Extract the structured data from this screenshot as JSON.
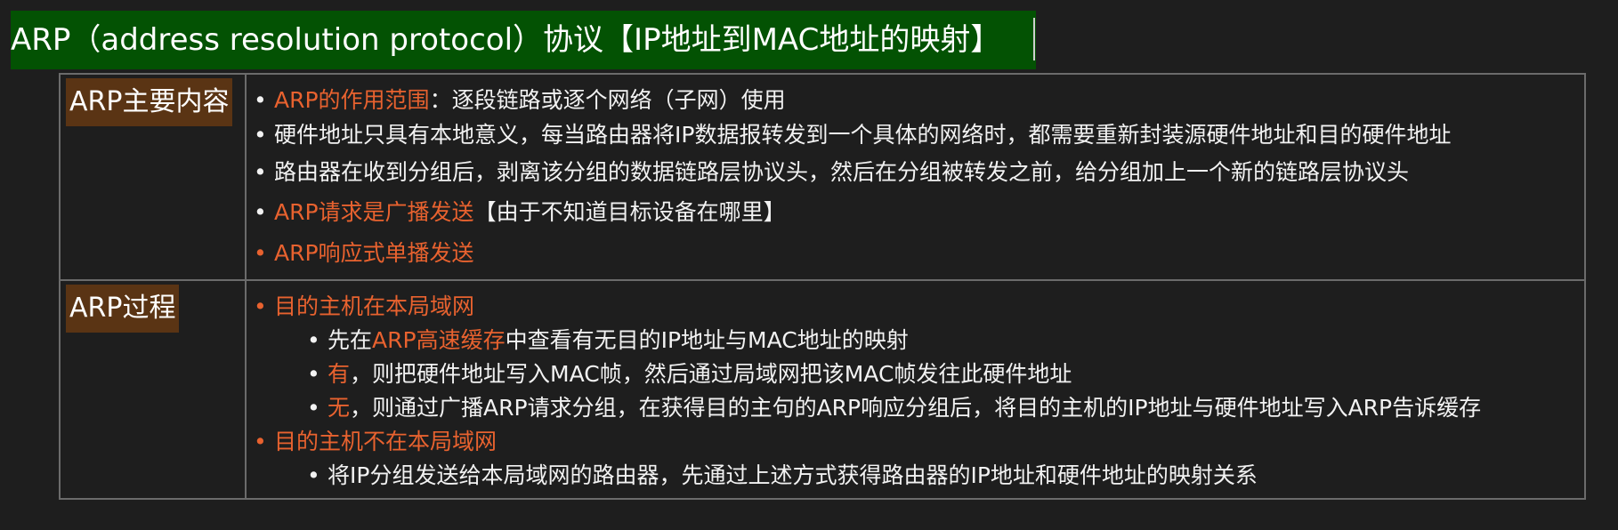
{
  "title": "ARP（address resolution protocol）协议【IP地址到MAC地址的映射】",
  "colors": {
    "title_bg": "#035203",
    "label_bg": "#5a3414",
    "accent": "#e8622f",
    "background": "#1e1e1e"
  },
  "sections": [
    {
      "label": "ARP主要内容",
      "items": [
        {
          "level": 1,
          "parts": [
            {
              "text": "ARP的作用范围",
              "color": "orange"
            },
            {
              "text": "：逐段链路或逐个网络（子网）使用",
              "color": "white"
            }
          ]
        },
        {
          "level": 1,
          "parts": [
            {
              "text": "硬件地址只具有本地意义，每当路由器将IP数据报转发到一个具体的网络时，都需要重新封装源硬件地址和目的硬件地址",
              "color": "white"
            }
          ]
        },
        {
          "level": 1,
          "parts": [
            {
              "text": "路由器在收到分组后，剥离该分组的数据链路层协议头，然后在分组被转发之前，给分组加上一个新的链路层协议头",
              "color": "white"
            }
          ]
        },
        {
          "level": 1,
          "parts": [
            {
              "text": "ARP请求是广播发送",
              "color": "orange"
            },
            {
              "text": "【由于不知道目标设备在哪里】",
              "color": "white"
            }
          ]
        },
        {
          "level": 1,
          "parts": [
            {
              "text": "ARP响应式单播发送",
              "color": "orange"
            }
          ]
        }
      ]
    },
    {
      "label": "ARP过程",
      "items": [
        {
          "level": 1,
          "parts": [
            {
              "text": "目的主机在本局域网",
              "color": "orange"
            }
          ]
        },
        {
          "level": 2,
          "parts": [
            {
              "text": "先在",
              "color": "white"
            },
            {
              "text": "ARP高速缓存",
              "color": "orange"
            },
            {
              "text": "中查看有无目的IP地址与MAC地址的映射",
              "color": "white"
            }
          ]
        },
        {
          "level": 2,
          "parts": [
            {
              "text": "有",
              "color": "orange"
            },
            {
              "text": "，则把硬件地址写入MAC帧，然后通过局域网把该MAC帧发往此硬件地址",
              "color": "white"
            }
          ]
        },
        {
          "level": 2,
          "parts": [
            {
              "text": "无",
              "color": "orange"
            },
            {
              "text": "，则通过广播ARP请求分组，在获得目的主句的ARP响应分组后，将目的主机的IP地址与硬件地址写入ARP告诉缓存",
              "color": "white"
            }
          ]
        },
        {
          "level": 1,
          "parts": [
            {
              "text": "目的主机不在本局域网",
              "color": "orange"
            }
          ]
        },
        {
          "level": 2,
          "parts": [
            {
              "text": "将IP分组发送给本局域网的路由器，先通过上述方式获得路由器的IP地址和硬件地址的映射关系",
              "color": "white"
            }
          ]
        }
      ]
    }
  ]
}
